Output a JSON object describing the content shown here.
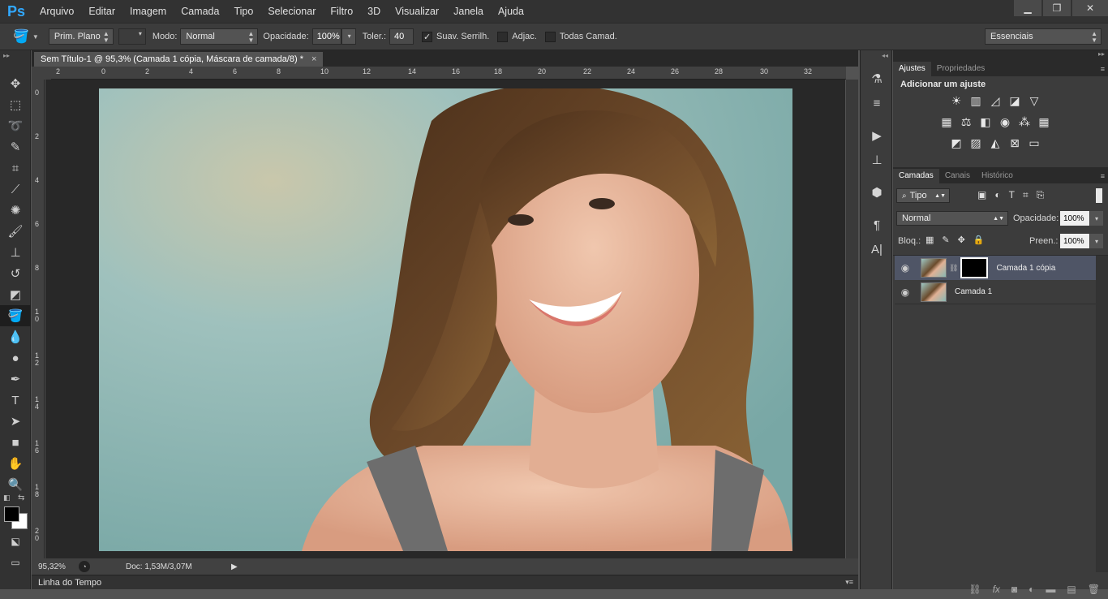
{
  "app": {
    "logo": "Ps"
  },
  "menu": [
    "Arquivo",
    "Editar",
    "Imagem",
    "Camada",
    "Tipo",
    "Selecionar",
    "Filtro",
    "3D",
    "Visualizar",
    "Janela",
    "Ajuda"
  ],
  "window_controls": {
    "minimize": "▁",
    "restore": "❐",
    "close": "✕"
  },
  "options": {
    "mode_prefix": "Prim. Plano",
    "modo_label": "Modo:",
    "modo_value": "Normal",
    "opacidade_label": "Opacidade:",
    "opacidade_value": "100%",
    "toler_label": "Toler.:",
    "toler_value": "40",
    "suav_label": "Suav. Serrilh.",
    "suav_checked": "✓",
    "adjac_label": "Adjac.",
    "todas_label": "Todas Camad.",
    "workspace": "Essenciais"
  },
  "document": {
    "tab_title": "Sem Título-1 @ 95,3% (Camada 1 cópia, Máscara de camada/8) *",
    "tab_close": "×",
    "zoom": "95,32%",
    "doc_info": "Doc: 1,53M/3,07M"
  },
  "rulers": {
    "top": [
      "2",
      "0",
      "2",
      "4",
      "6",
      "8",
      "10",
      "12",
      "14",
      "16",
      "18",
      "20",
      "22",
      "24",
      "26",
      "28",
      "30",
      "32"
    ],
    "left": [
      "0",
      "2",
      "4",
      "6",
      "8",
      "1\n0",
      "1\n2",
      "1\n4",
      "1\n6",
      "1\n8",
      "2\n0"
    ]
  },
  "timeline": {
    "label": "Linha do Tempo"
  },
  "adjustments_panel": {
    "tab_ajustes": "Ajustes",
    "tab_propriedades": "Propriedades",
    "heading": "Adicionar um ajuste"
  },
  "layers_panel": {
    "tab_camadas": "Camadas",
    "tab_canais": "Canais",
    "tab_historico": "Histórico",
    "filter_kind": "Tipo",
    "blend_mode": "Normal",
    "opacidade_label": "Opacidade:",
    "opacidade_value": "100%",
    "bloq_label": "Bloq.:",
    "preen_label": "Preen.:",
    "preen_value": "100%",
    "layers": [
      {
        "name": "Camada 1 cópia",
        "selected": true,
        "has_mask": true
      },
      {
        "name": "Camada 1",
        "selected": false,
        "has_mask": false
      }
    ]
  },
  "colors": {
    "accent": "#31a8ff",
    "selected_layer": "#4f5566",
    "canvas_bg": "#282828"
  }
}
